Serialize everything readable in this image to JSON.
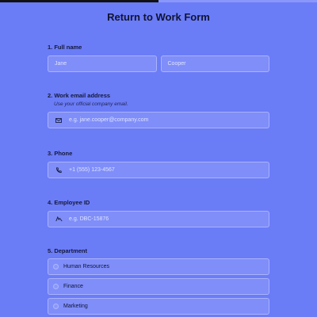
{
  "progress": {
    "fraction": 0.5
  },
  "form": {
    "title": "Return to Work Form"
  },
  "questions": {
    "full_name": {
      "label": "1.  Full name",
      "first_placeholder": "Jane",
      "last_placeholder": "Cooper"
    },
    "email": {
      "label": "2.  Work email address",
      "sublabel": "Use your official company email.",
      "placeholder": "e.g. jane.cooper@company.com",
      "icon": "envelope-icon"
    },
    "phone": {
      "label": "3.  Phone",
      "placeholder": "+1 (555) 123-4567",
      "icon": "phone-icon"
    },
    "employee_id": {
      "label": "4.  Employee ID",
      "placeholder": "e.g. DBC-15876",
      "icon": "id-icon"
    },
    "department": {
      "label": "5.  Department",
      "options": [
        "Human Resources",
        "Finance",
        "Marketing"
      ]
    }
  },
  "colors": {
    "background": "#6b7cf7",
    "field_bg": "#7f8ef9",
    "field_border": "#a9b3fc",
    "progress_fill": "#111111"
  }
}
